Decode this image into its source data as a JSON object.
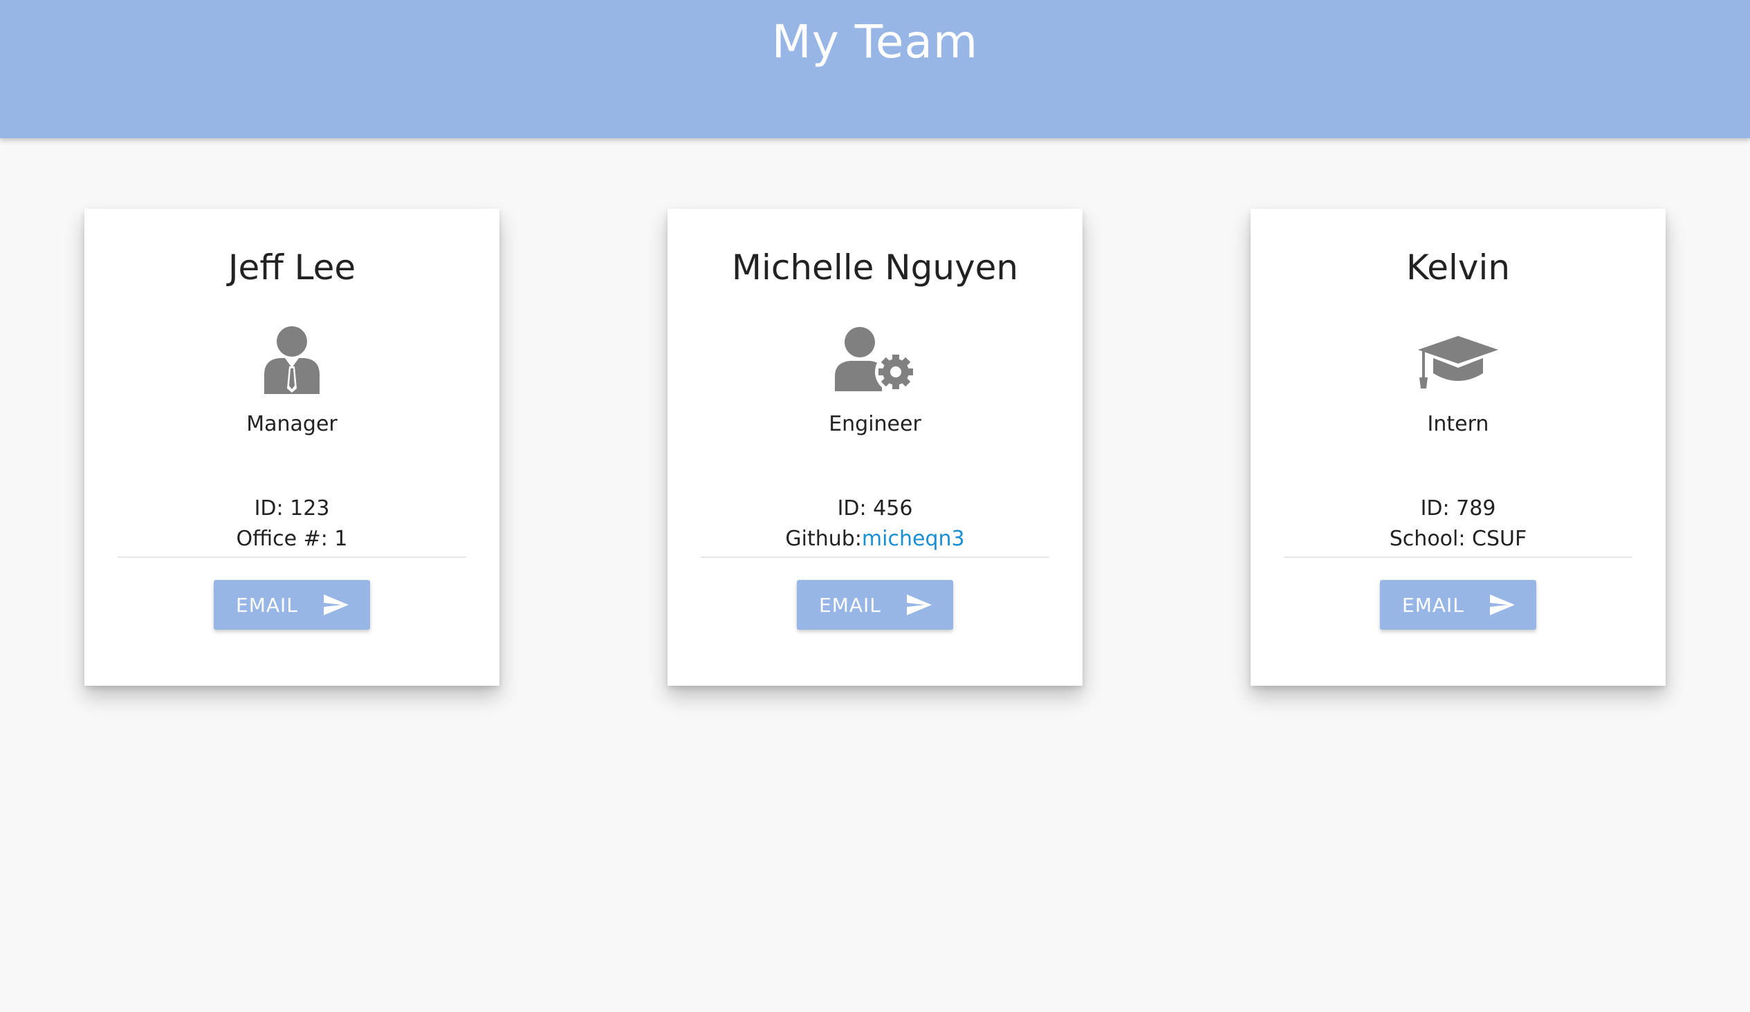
{
  "header": {
    "title": "My Team",
    "background_color": "#97b6e6"
  },
  "team": [
    {
      "name": "Jeff Lee",
      "role": "Manager",
      "role_icon": "manager-icon",
      "id_text": "ID: 123",
      "extra_prefix": "Office #: 1",
      "extra_link": "",
      "email_label": "EMAIL"
    },
    {
      "name": "Michelle Nguyen",
      "role": "Engineer",
      "role_icon": "engineer-icon",
      "id_text": "ID: 456",
      "extra_prefix": "Github:",
      "extra_link": "micheqn3",
      "email_label": "EMAIL"
    },
    {
      "name": "Kelvin",
      "role": "Intern",
      "role_icon": "graduation-cap-icon",
      "id_text": "ID: 789",
      "extra_prefix": "School: CSUF",
      "extra_link": "",
      "email_label": "EMAIL"
    }
  ],
  "colors": {
    "accent": "#97b6e6",
    "link": "#1a8fd6",
    "icon": "#808080"
  }
}
